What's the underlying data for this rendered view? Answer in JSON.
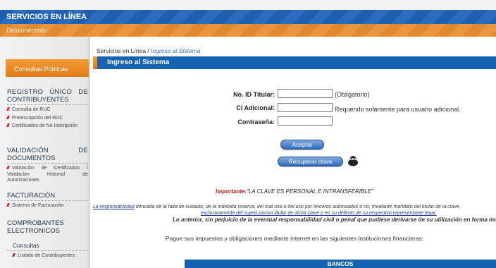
{
  "header": {
    "title": "SERVICIOS EN LÍNEA",
    "status": "Desconectado"
  },
  "sidebar": {
    "tab": "Consultas Públicas",
    "sections": [
      {
        "title_a": "REGISTRO",
        "title_b": "ÚNICO",
        "title_c": "DE",
        "title_d": "CONTRIBUYENTES",
        "items": [
          "Consulta de RUC",
          "Preinscripción del RUC",
          "Certificados de No Inscripción"
        ]
      },
      {
        "title_a": "VALIDACIÓN",
        "title_b": "DE",
        "title_d": "DOCUMENTOS",
        "items": [
          "Validación de Certificados / Validación Historial de Autorizaciones"
        ]
      },
      {
        "title_d": "FACTURACIÓN",
        "items": [
          "Sistema de Facturación"
        ]
      },
      {
        "title_d": "COMPROBANTES ELECTRONICOS",
        "subhead": "Consultas",
        "items": [
          "Listado de Contribuyentes"
        ]
      }
    ]
  },
  "breadcrumb": {
    "root": "Servicios en Línea",
    "sep": " / ",
    "current": "Ingreso al Sistema"
  },
  "panel": {
    "title": "Ingreso al Sistema"
  },
  "form": {
    "id_label": "No. ID Titular:",
    "id_note": "(Obligatorio)",
    "ci_label": "CI Adicional:",
    "ci_note": "Requerido solamente para usuario adicional.",
    "pass_label": "Contraseña:",
    "id_value": "",
    "ci_value": "",
    "pass_value": ""
  },
  "buttons": {
    "accept": "Aceptar",
    "recover": "Recuperar clave"
  },
  "notice": {
    "important_prefix": "Importante:",
    "important_text": "\"LA CLAVE ES PERSONAL E INTRANSFERIBLE\"",
    "resp_link": "La responsabilidad",
    "resp_text": " derivada de la falta de cuidado, de la indebida reserva, del mal uso o del uso por terceros autorizados o no, mediante mandato del titular de la clave,",
    "resp_line2": "exclusivamente del sujeto pasivo titular de dicha clave o en su defecto de su respectivo representante legal.",
    "resp_line3": "Lo anterior, sin perjuicio de la eventual responsabilidad civil o penal que pudiese derivarse de su utilización en forma ind",
    "pay": "Pague sus impuestos y obligaciones mediante internet en las siguientes instituciones financieras:",
    "banks": "BANCOS"
  },
  "colors": {
    "brand_blue": "#1561b2",
    "accent_orange": "#e07c19",
    "important_red": "#c0201a"
  }
}
